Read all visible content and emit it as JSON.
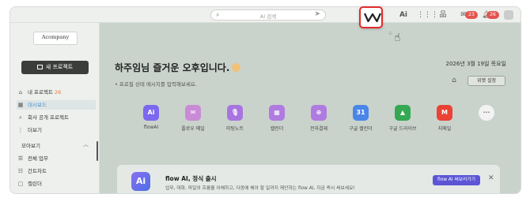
{
  "topbar": {
    "search_placeholder": "AI 검색",
    "ai_label": "Ai",
    "mail_badge": "23",
    "bell_badge": "26",
    "colors": {
      "badge": "#e35450",
      "highlight_border": "#e02b2b"
    }
  },
  "sidebar": {
    "logo_name": "Acompany",
    "logo_sub": "...",
    "new_project_label": "새 프로젝트",
    "items": [
      {
        "label": "내 프로젝트",
        "count": "26"
      },
      {
        "label": "대시보드"
      },
      {
        "label": "회사 공개 프로젝트"
      },
      {
        "label": "더보기"
      }
    ],
    "section_title": "모아보기",
    "section_items": [
      {
        "label": "전체 업무"
      },
      {
        "label": "간트차트"
      },
      {
        "label": "캘린더"
      }
    ]
  },
  "main": {
    "greeting": "하주임님 즐거운 오후입니다.",
    "status_placeholder": "프로필 상태 메시지를 입력해보세요.",
    "date": "2026년 3월 19일 목요일",
    "widget_label": "위젯 설정",
    "apps": [
      {
        "label": "flowAI",
        "color": "#7b68ee",
        "glyph": "Ai"
      },
      {
        "label": "플로우 메일",
        "color": "#c98ad6",
        "glyph": "✉"
      },
      {
        "label": "미팅노트",
        "color": "#a875e0",
        "glyph": "🎙"
      },
      {
        "label": "캘린더",
        "color": "#b07be0",
        "glyph": "▦"
      },
      {
        "label": "전자결재",
        "color": "#b07be0",
        "glyph": "⊕"
      },
      {
        "label": "구글 캘린더",
        "color": "#4a86e8",
        "glyph": "31"
      },
      {
        "label": "구글 드라이브",
        "color": "#34a853",
        "glyph": "▲"
      },
      {
        "label": "지메일",
        "color": "#ea4335",
        "glyph": "M"
      },
      {
        "label": "",
        "color": "#f3f3f3",
        "glyph": "···"
      }
    ],
    "banner": {
      "title": "flow AI, 정식 출시",
      "desc": "업무, 대화, 파일의 흐름을 이해하고, 다음에 해야 할 일까지 제안하는 flow AI, 지금 즉시 써보세요!",
      "button": "flow AI 써보러가기"
    }
  }
}
